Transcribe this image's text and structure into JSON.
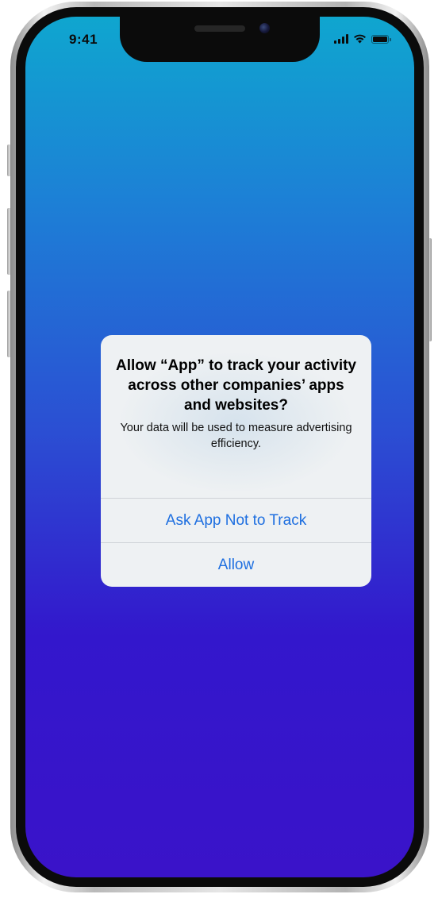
{
  "status_bar": {
    "time": "9:41",
    "icons": [
      "cellular-signal-icon",
      "wifi-icon",
      "battery-icon"
    ]
  },
  "alert": {
    "title": "Allow “App” to track your activity across other companies’ apps and websites?",
    "message": "Your data will be used to measure advertising efficiency.",
    "buttons": [
      {
        "label": "Ask App Not to Track"
      },
      {
        "label": "Allow"
      }
    ]
  },
  "colors": {
    "accent": "#1e6fe0",
    "wallpaper_top": "#0fa6cf",
    "wallpaper_bottom": "#3a13c9",
    "alert_background": "#eef1f3"
  }
}
